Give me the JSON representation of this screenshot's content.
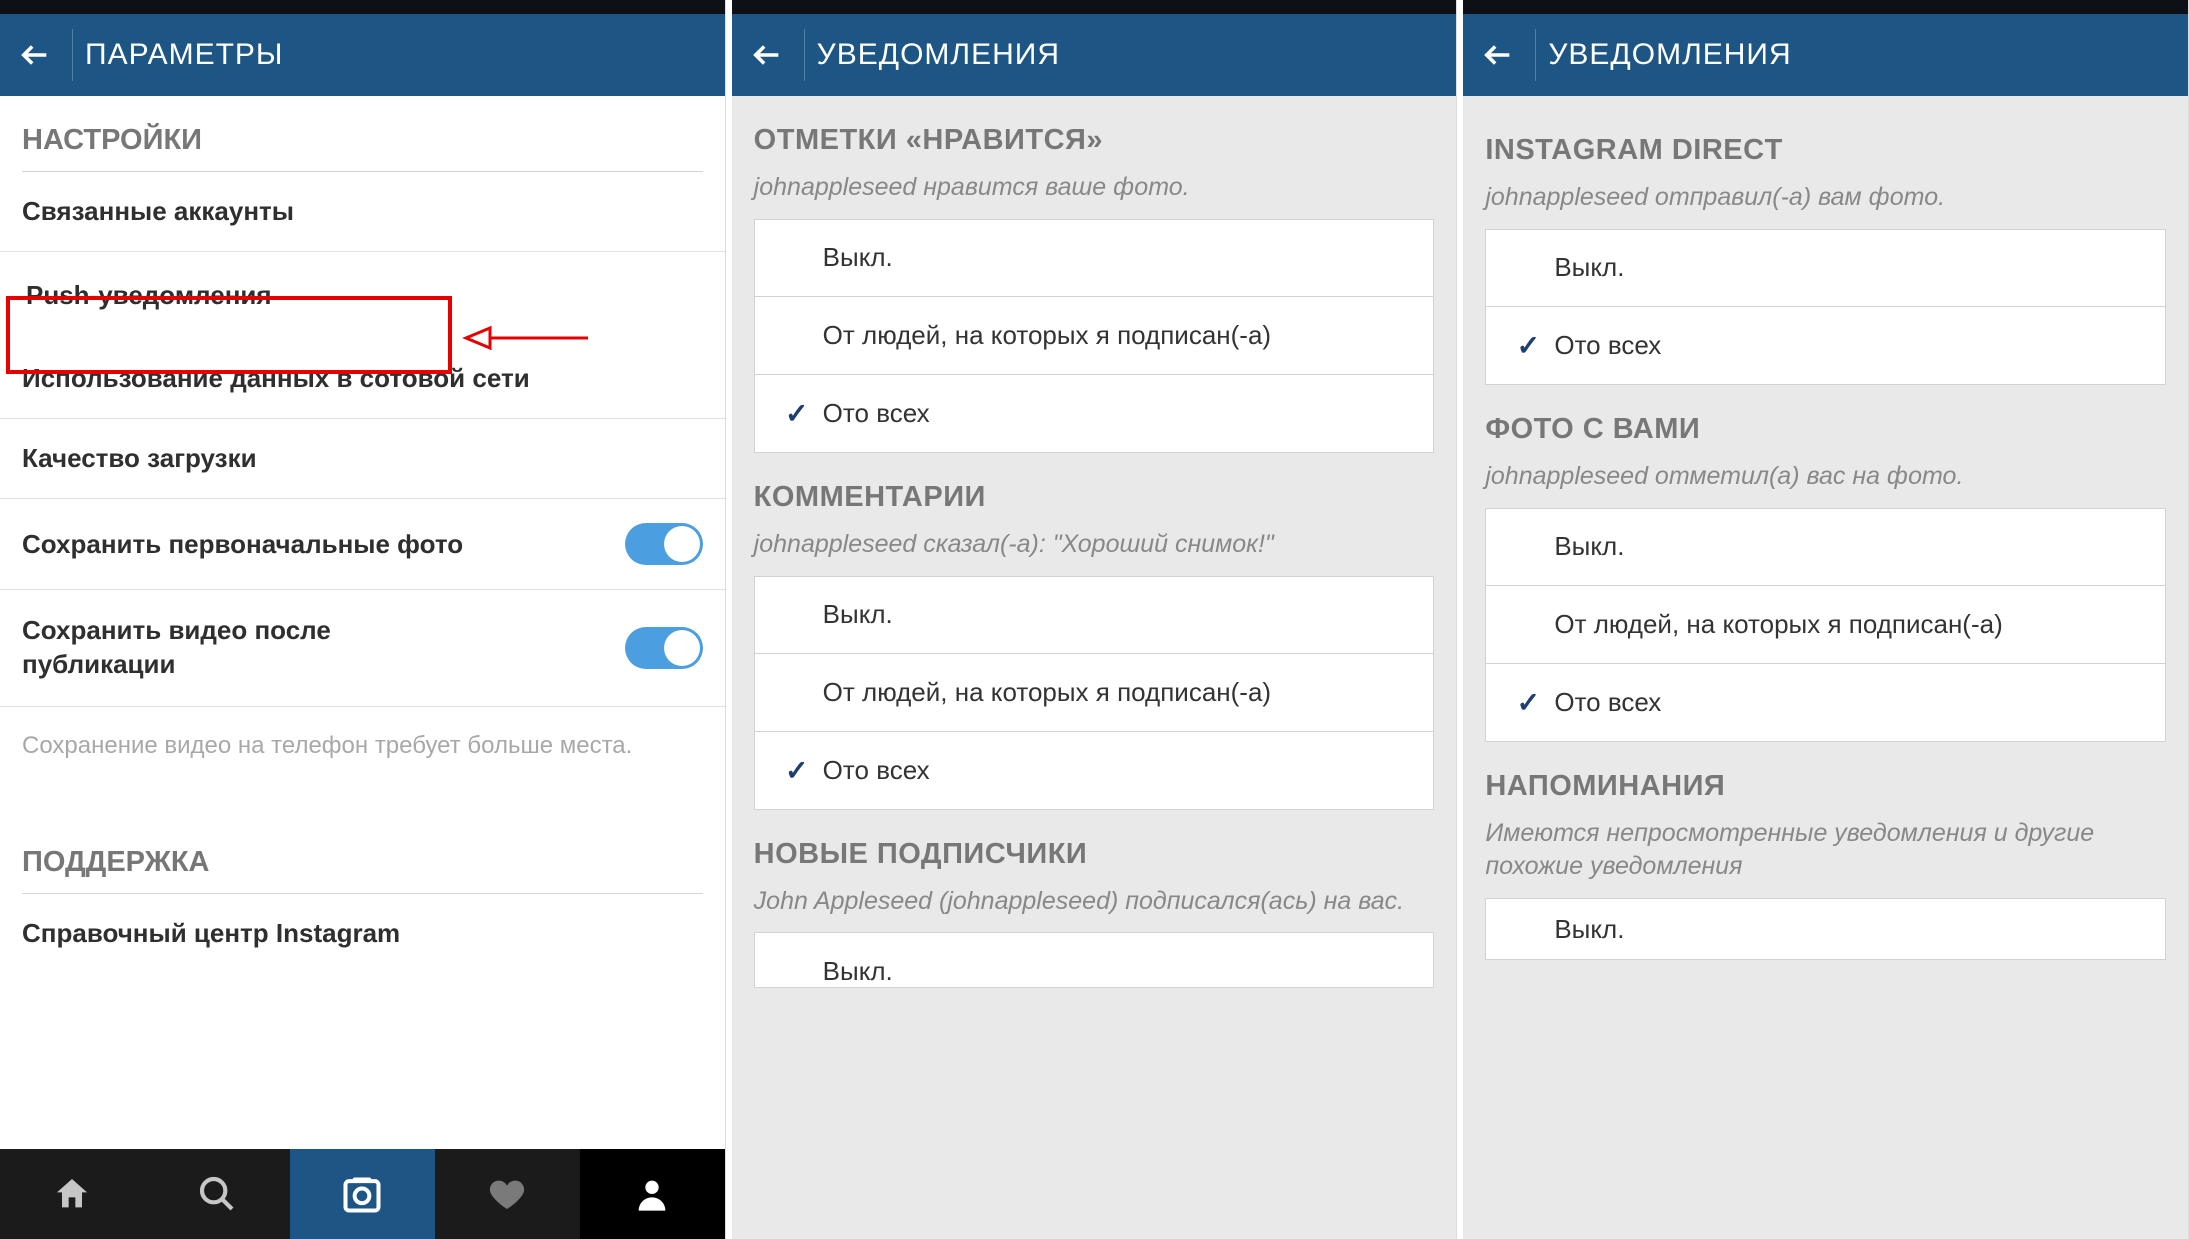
{
  "screen1": {
    "header_title": "ПАРАМЕТРЫ",
    "section_settings": "НАСТРОЙКИ",
    "items": {
      "linked_accounts": "Связанные аккаунты",
      "push_notifications": "Push-уведомления",
      "data_usage": "Использование данных в сотовой сети",
      "upload_quality": "Качество загрузки",
      "save_original": "Сохранить первоначальные фото",
      "save_video": "Сохранить видео после публикации"
    },
    "helper": "Сохранение видео на телефон требует больше места.",
    "section_support": "ПОДДЕРЖКА",
    "support_center": "Справочный центр Instagram"
  },
  "screen2": {
    "header_title": "УВЕДОМЛЕНИЯ",
    "groups": {
      "likes": {
        "title": "ОТМЕТКИ «НРАВИТСЯ»",
        "subtitle": "johnappleseed нравится ваше фото.",
        "options": {
          "off": "Выкл.",
          "following": "От людей, на которых я подписан(-а)",
          "everyone": "Ото всех"
        },
        "selected": "everyone"
      },
      "comments": {
        "title": "КОММЕНТАРИИ",
        "subtitle": "johnappleseed сказал(-а): \"Хороший снимок!\"",
        "options": {
          "off": "Выкл.",
          "following": "От людей, на которых я подписан(-а)",
          "everyone": "Ото всех"
        },
        "selected": "everyone"
      },
      "followers": {
        "title": "НОВЫЕ ПОДПИСЧИКИ",
        "subtitle": "John Appleseed (johnappleseed) подписался(ась) на вас.",
        "options": {
          "off": "Выкл."
        }
      }
    }
  },
  "screen3": {
    "header_title": "УВЕДОМЛЕНИЯ",
    "groups": {
      "direct": {
        "title": "INSTAGRAM DIRECT",
        "subtitle": "johnappleseed отправил(-а) вам фото.",
        "options": {
          "off": "Выкл.",
          "everyone": "Ото всех"
        },
        "selected": "everyone"
      },
      "photos_of_you": {
        "title": "ФОТО С ВАМИ",
        "subtitle": "johnappleseed отметил(а) вас на фото.",
        "options": {
          "off": "Выкл.",
          "following": "От людей, на которых я подписан(-а)",
          "everyone": "Ото всех"
        },
        "selected": "everyone"
      },
      "reminders": {
        "title": "НАПОМИНАНИЯ",
        "subtitle": "Имеются непросмотренные уведомления и другие похожие уведомления",
        "options": {
          "off": "Выкл."
        }
      }
    }
  }
}
